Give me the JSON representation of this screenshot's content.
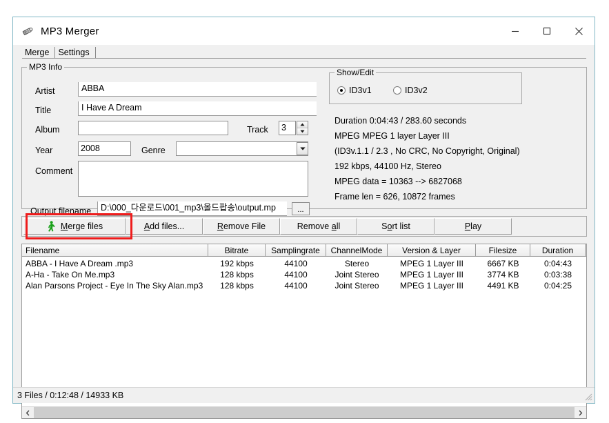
{
  "window": {
    "title": "MP3 Merger",
    "icon": "mp3-merger-icon",
    "controls": {
      "minimize": "—",
      "maximize": "□",
      "close": "✕"
    }
  },
  "tabs": [
    {
      "label": "Merge",
      "active": true
    },
    {
      "label": "Settings",
      "active": false
    }
  ],
  "mp3_info": {
    "group_title": "MP3 Info",
    "fields": {
      "artist": {
        "label": "Artist",
        "value": "ABBA",
        "placeholder": ""
      },
      "title": {
        "label": "Title",
        "value": "I Have A Dream",
        "placeholder": ""
      },
      "album": {
        "label": "Album",
        "value": "",
        "placeholder": ""
      },
      "track": {
        "label": "Track",
        "value": "3"
      },
      "year": {
        "label": "Year",
        "value": "2008",
        "placeholder": ""
      },
      "genre": {
        "label": "Genre",
        "value": "",
        "placeholder": ""
      },
      "comment": {
        "label": "Comment",
        "value": "",
        "placeholder": ""
      },
      "output_filename": {
        "label": "Output filename",
        "value": "D:\\000_다운로드\\001_mp3\\올드팝송\\output.mp",
        "browse_label": "..."
      }
    }
  },
  "show_edit": {
    "group_title": "Show/Edit",
    "options": [
      {
        "label": "ID3v1",
        "selected": true
      },
      {
        "label": "ID3v2",
        "selected": false
      }
    ]
  },
  "details": {
    "lines": [
      "Duration 0:04:43 / 283.60 seconds",
      "MPEG MPEG 1 layer Layer III",
      "(ID3v.1.1  / 2.3 , No CRC, No Copyright, Original)",
      "192 kbps, 44100 Hz, Stereo",
      "MPEG data = 10363 --> 6827068",
      "Frame len = 626, 10872 frames"
    ]
  },
  "toolbar": {
    "merge_label": "Merge files",
    "merge_icon": "green-walking-man-icon",
    "add_label": "Add files...",
    "remove_file_label": "Remove File",
    "remove_all_label": "Remove all",
    "sort_list_label": "Sort list",
    "play_label": "Play",
    "highlight_color": "#ee1c1c"
  },
  "filelist": {
    "columns": [
      "Filename",
      "Bitrate",
      "Samplingrate",
      "ChannelMode",
      "Version & Layer",
      "Filesize",
      "Duration"
    ],
    "rows": [
      {
        "filename": "ABBA - I Have A Dream .mp3",
        "bitrate": "192 kbps",
        "samplingrate": "44100",
        "channelmode": "Stereo",
        "version": "MPEG 1 Layer III",
        "filesize": "6667 KB",
        "duration": "0:04:43"
      },
      {
        "filename": "A-Ha - Take On Me.mp3",
        "bitrate": "128 kbps",
        "samplingrate": "44100",
        "channelmode": "Joint Stereo",
        "version": "MPEG 1 Layer III",
        "filesize": "3774 KB",
        "duration": "0:03:38"
      },
      {
        "filename": "Alan Parsons Project - Eye In The Sky Alan.mp3",
        "bitrate": "128 kbps",
        "samplingrate": "44100",
        "channelmode": "Joint Stereo",
        "version": "MPEG 1 Layer III",
        "filesize": "4491 KB",
        "duration": "0:04:25"
      }
    ],
    "scroll_left_icon": "chevron-left-icon",
    "scroll_right_icon": "chevron-right-icon"
  },
  "statusbar": {
    "text": "3 Files / 0:12:48 / 14933 KB"
  }
}
